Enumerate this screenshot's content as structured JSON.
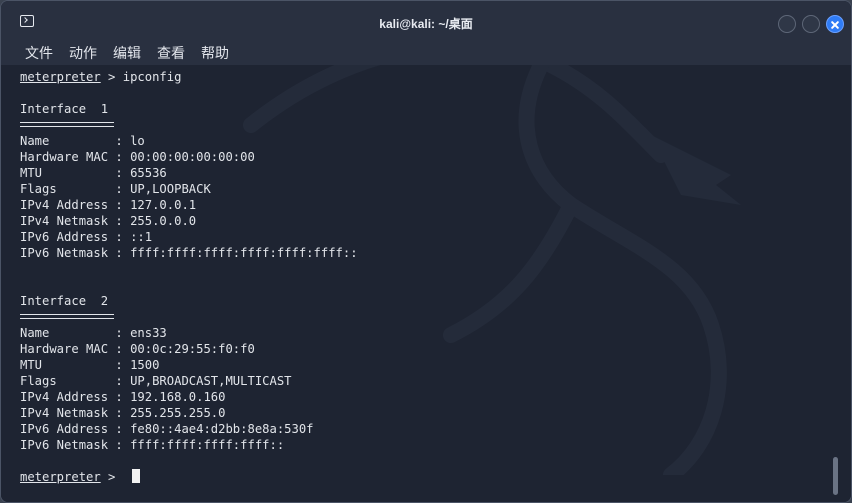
{
  "window": {
    "title": "kali@kali: ~/桌面"
  },
  "menu": [
    "文件",
    "动作",
    "编辑",
    "查看",
    "帮助"
  ],
  "terminal": {
    "prompt": "meterpreter",
    "command_line": " > ipconfig",
    "prompt_suffix": " >",
    "interfaces": [
      {
        "header": "Interface  1",
        "rows": [
          {
            "key": "Name         ",
            "value": "lo"
          },
          {
            "key": "Hardware MAC ",
            "value": "00:00:00:00:00:00"
          },
          {
            "key": "MTU          ",
            "value": "65536"
          },
          {
            "key": "Flags        ",
            "value": "UP,LOOPBACK"
          },
          {
            "key": "IPv4 Address ",
            "value": "127.0.0.1"
          },
          {
            "key": "IPv4 Netmask ",
            "value": "255.0.0.0"
          },
          {
            "key": "IPv6 Address ",
            "value": "::1"
          },
          {
            "key": "IPv6 Netmask ",
            "value": "ffff:ffff:ffff:ffff:ffff:ffff::"
          }
        ]
      },
      {
        "header": "Interface  2",
        "rows": [
          {
            "key": "Name         ",
            "value": "ens33"
          },
          {
            "key": "Hardware MAC ",
            "value": "00:0c:29:55:f0:f0"
          },
          {
            "key": "MTU          ",
            "value": "1500"
          },
          {
            "key": "Flags        ",
            "value": "UP,BROADCAST,MULTICAST"
          },
          {
            "key": "IPv4 Address ",
            "value": "192.168.0.160"
          },
          {
            "key": "IPv4 Netmask ",
            "value": "255.255.255.0"
          },
          {
            "key": "IPv6 Address ",
            "value": "fe80::4ae4:d2bb:8e8a:530f"
          },
          {
            "key": "IPv6 Netmask ",
            "value": "ffff:ffff:ffff:ffff::"
          }
        ]
      }
    ]
  },
  "colors": {
    "background": "#1e2432",
    "titlebar": "#293040",
    "text": "#e2e5ea",
    "close_button": "#2f7cf6"
  },
  "icons": {
    "app": "terminal-icon",
    "background": "kali-dragon-logo"
  }
}
